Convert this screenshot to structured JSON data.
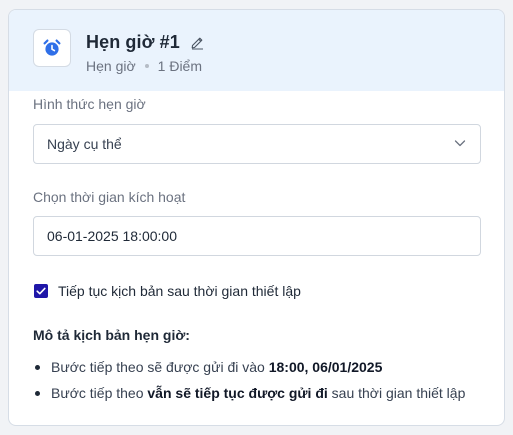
{
  "header": {
    "title": "Hẹn giờ #1",
    "type_label": "Hẹn giờ",
    "points": "1 Điểm",
    "icon": "alarm-clock-icon",
    "edit_icon": "pencil-icon"
  },
  "form": {
    "schedule_type": {
      "label": "Hình thức hẹn giờ",
      "value": "Ngày cụ thể"
    },
    "trigger_time": {
      "label": "Chọn thời gian kích hoạt",
      "value": "06-01-2025 18:00:00"
    },
    "continue_checkbox": {
      "label": "Tiếp tục kịch bản sau thời gian thiết lập",
      "checked": true
    }
  },
  "description": {
    "title": "Mô tả kịch bản hẹn giờ:",
    "items": [
      {
        "prefix": "Bước tiếp theo sẽ được gửi đi vào ",
        "bold": "18:00, 06/01/2025",
        "suffix": ""
      },
      {
        "prefix": "Bước tiếp theo ",
        "bold": "vẫn sẽ tiếp tục được gửi đi",
        "suffix": " sau thời gian thiết lập"
      }
    ]
  },
  "colors": {
    "accent": "#1f16a8",
    "icon_blue": "#2f6fe8",
    "header_bg": "#eaf3fd"
  }
}
